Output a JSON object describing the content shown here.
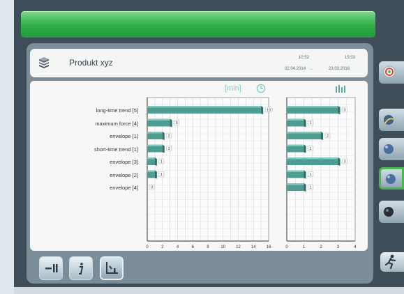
{
  "header": {
    "title": "Produkt xyz",
    "time_from": "10:52",
    "time_to": "15:03",
    "date_from": "02.04.2014",
    "separator": "...",
    "date_to": "23.03.2016",
    "product_icon": "product-stack-icon"
  },
  "chart_header": {
    "unit_label": "[min]",
    "clock_icon": "clock-icon",
    "histogram_icon": "histogram-icon"
  },
  "toolbar": {
    "buttons": [
      {
        "icon": "zero-reset-icon",
        "selected": false
      },
      {
        "icon": "info-icon",
        "selected": false
      },
      {
        "icon": "ruler-marker-icon",
        "selected": true
      }
    ]
  },
  "sidebar": {
    "buttons": [
      {
        "icon": "target-icon",
        "selected": false
      },
      {
        "icon": "globe-1-icon",
        "selected": false
      },
      {
        "icon": "globe-2-icon",
        "selected": false
      },
      {
        "icon": "globe-3-icon",
        "selected": true
      },
      {
        "icon": "globe-4-icon",
        "selected": false
      }
    ],
    "exit_icon": "running-exit-icon"
  },
  "colors": {
    "bar": "#4f9c92",
    "bar_top": "#7ec9bc",
    "bar_side": "#2f6e66",
    "title_bar": "#2fae48",
    "frame": "#3e4d57"
  },
  "chart_data": [
    {
      "type": "bar",
      "orientation": "horizontal",
      "categories": [
        "long-time trend [5]",
        "maximum force [4]",
        "envelope [1]",
        "short-time trend [1]",
        "envelope [3]",
        "envelope [2]",
        "envelope [4]"
      ],
      "values": [
        15,
        3,
        2,
        2,
        1,
        1,
        0
      ],
      "data_labels": [
        "15",
        "3",
        "2",
        "2",
        "1",
        "1",
        "0"
      ],
      "xlim": [
        0,
        16
      ],
      "xticks": [
        "0",
        "2",
        "4",
        "6",
        "8",
        "10",
        "12",
        "14",
        "16"
      ],
      "grid": true
    },
    {
      "type": "bar",
      "orientation": "horizontal",
      "categories": [
        "long-time trend [5]",
        "maximum force [4]",
        "envelope [1]",
        "short-time trend [1]",
        "envelope [3]",
        "envelope [2]",
        "envelope [4]"
      ],
      "values": [
        3,
        1,
        2,
        1,
        3,
        1,
        1
      ],
      "data_labels": [
        "3",
        "1",
        "2",
        "1",
        "3",
        "1",
        "1"
      ],
      "xlim": [
        0,
        4
      ],
      "xticks": [
        "0",
        "1",
        "2",
        "3",
        "4"
      ],
      "grid": true
    }
  ]
}
